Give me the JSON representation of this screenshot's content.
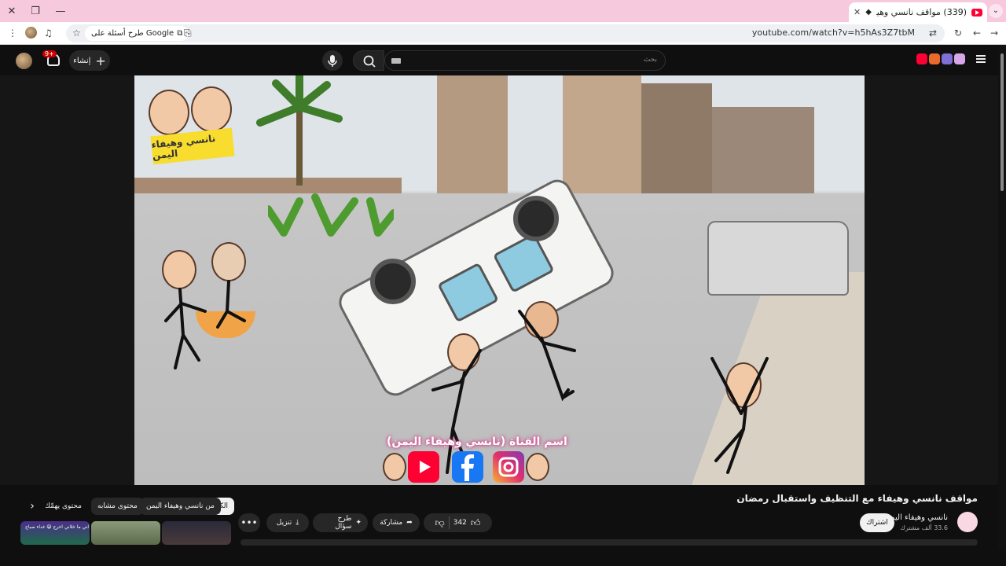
{
  "browser": {
    "tab_title": "(339) مواقف نانسي وهيفاء مـ",
    "new_tab": "+",
    "url": "youtube.com/watch?v=h5hAs3Z7tbM",
    "search_pill": "طرح أسئلة على Google",
    "window_controls": {
      "close": "✕",
      "restore": "❐",
      "minimize": "—"
    }
  },
  "youtube": {
    "search_placeholder": "بحث",
    "create_label": "إنشاء",
    "notifications_count": "9+",
    "accent_color": "#ff0033"
  },
  "video": {
    "logo_caption": "نانسي وهيفاء اليمن",
    "channel_caption": "اسم القناة (نانسي وهيفاء اليمن)",
    "title": "مواقف نانسي وهيفاء مع التنظيف واستقبال رمضان",
    "channel_name": "نانسي وهيفاء اليمن",
    "subscribers": "33.6 ألف مشترك",
    "subscribe_label": "اشتراك",
    "likes": "342",
    "share_label": "مشاركة",
    "ask_label": "طرح سؤال",
    "download_label": "تنزيل"
  },
  "chips": [
    {
      "label": "الكل",
      "active": true
    },
    {
      "label": "من نانسي وهيفاء اليمن",
      "active": false
    },
    {
      "label": "محتوى مشابه",
      "active": false
    },
    {
      "label": "محتوى يهمّك",
      "active": false
    }
  ],
  "thumb_caption": "اني ما خلاني اخرج 😅 غداء صباح"
}
